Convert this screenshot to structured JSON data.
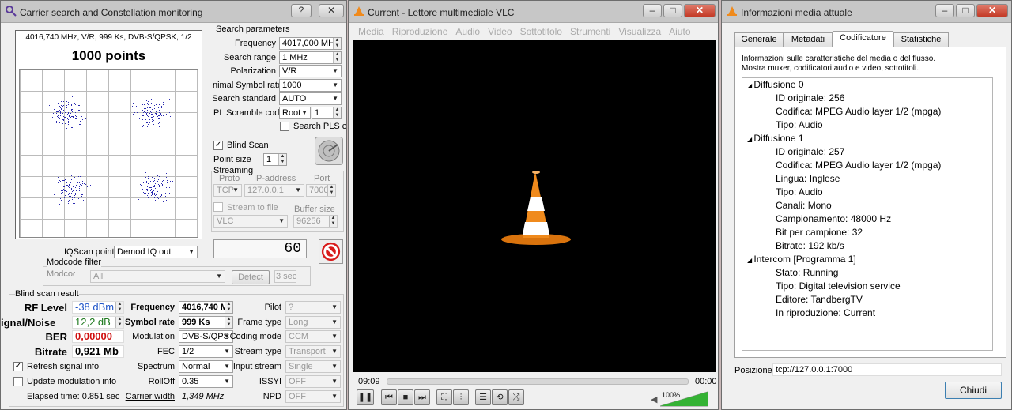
{
  "carrier": {
    "title": "Carrier search and Constellation monitoring",
    "constellation": {
      "info": "4016,740 MHz, V/R, 999 Ks, DVB-S/QPSK, 1/2",
      "points_label": "1000 points"
    },
    "search_params": {
      "heading": "Search parameters",
      "frequency_label": "Frequency",
      "frequency_value": "4017,000 MHz",
      "range_label": "Search range",
      "range_value": "1 MHz",
      "polarization_label": "Polarization",
      "polarization_value": "V/R",
      "symrate_label": "nimal Symbol rate",
      "symrate_value": "1000",
      "standard_label": "Search standard",
      "standard_value": "AUTO",
      "pls_label": "PL Scramble code",
      "pls_mode": "Root",
      "pls_value": "1",
      "search_pls_label": "Search PLS cc"
    },
    "blind_scan_label": "Blind Scan",
    "point_size_label": "Point size",
    "point_size_value": "1",
    "streaming": {
      "heading": "Streaming",
      "proto_label": "Proto",
      "ip_label": "IP-address",
      "port_label": "Port",
      "proto_value": "TCP",
      "ip_value": "127.0.0.1",
      "port_value": "7000",
      "stream_to_file_label": "Stream to file",
      "buffer_label": "Buffer size",
      "player_value": "VLC",
      "buffer_value": "96256"
    },
    "iq_label": "IQScan point",
    "iq_value": "Demod IQ out",
    "counter": "60",
    "modcode": {
      "heading": "Modcode filter",
      "label": "Modcode",
      "value": "All",
      "detect_label": "Detect",
      "sec_value": "3 sec"
    },
    "result": {
      "heading": "Blind scan result",
      "rf_label": "RF Level",
      "rf_value": "-38 dBm",
      "snr_label": "ignal/Noise",
      "snr_value": "12,2 dB",
      "ber_label": "BER",
      "ber_value": "0,00000",
      "bitrate_label": "Bitrate",
      "bitrate_value": "0,921 Mb",
      "freq_label": "Frequency",
      "freq_value": "4016,740 M",
      "symrate_label": "Symbol rate",
      "symrate_value": "999 Ks",
      "modulation_label": "Modulation",
      "modulation_value": "DVB-S/QPS",
      "fec_label": "FEC",
      "fec_value": "1/2",
      "spectrum_label": "Spectrum",
      "spectrum_value": "Normal",
      "rolloff_label": "RollOff",
      "rolloff_value": "0.35",
      "carrier_width_label": "Carrier width",
      "carrier_width_value": "1,349 MHz",
      "pilot_label": "Pilot",
      "pilot_value": "?",
      "frame_label": "Frame type",
      "frame_value": "Long",
      "coding_label": "Coding mode",
      "coding_value": "CCM",
      "stream_type_label": "Stream type",
      "stream_type_value": "Transport",
      "input_stream_label": "Input stream",
      "input_stream_value": "Single",
      "issyi_label": "ISSYI",
      "issyi_value": "OFF",
      "npd_label": "NPD",
      "npd_value": "OFF"
    },
    "refresh_label": "Refresh signal info",
    "update_label": "Update modulation info",
    "elapsed": "Elapsed time: 0.851 sec"
  },
  "vlc": {
    "title": "Current - Lettore multimediale VLC",
    "menu": [
      "Media",
      "Riproduzione",
      "Audio",
      "Video",
      "Sottotitolo",
      "Strumenti",
      "Visualizza",
      "Aiuto"
    ],
    "time_elapsed": "09:09",
    "time_total": "00:00",
    "volume": "100%",
    "volume_level": 1.0
  },
  "info": {
    "title": "Informazioni media attuale",
    "tabs": [
      "Generale",
      "Metadati",
      "Codificatore",
      "Statistiche"
    ],
    "description_1": "Informazioni sulle caratteristiche del media o del flusso.",
    "description_2": "Mostra muxer, codificatori audio e video, sottotitoli.",
    "tree": [
      {
        "name": "Diffusione 0",
        "items": [
          "ID originale: 256",
          "Codifica: MPEG Audio layer 1/2 (mpga)",
          "Tipo: Audio"
        ]
      },
      {
        "name": "Diffusione 1",
        "items": [
          "ID originale: 257",
          "Codifica: MPEG Audio layer 1/2 (mpga)",
          "Lingua: Inglese",
          "Tipo: Audio",
          "Canali: Mono",
          "Campionamento: 48000 Hz",
          "Bit per campione: 32",
          "Bitrate: 192 kb/s"
        ]
      },
      {
        "name": "Intercom [Programma 1]",
        "items": [
          "Stato: Running",
          "Tipo: Digital television service",
          "Editore: TandbergTV",
          "In riproduzione: Current"
        ]
      }
    ],
    "position_label": "Posizione:",
    "position_value": "tcp://127.0.0.1:7000",
    "close_label": "Chiudi"
  },
  "colors": {
    "rf": "#1f54c8",
    "snr": "#1f7a1f",
    "ber": "#d01010",
    "vlc_cone": "#f08a1c"
  }
}
